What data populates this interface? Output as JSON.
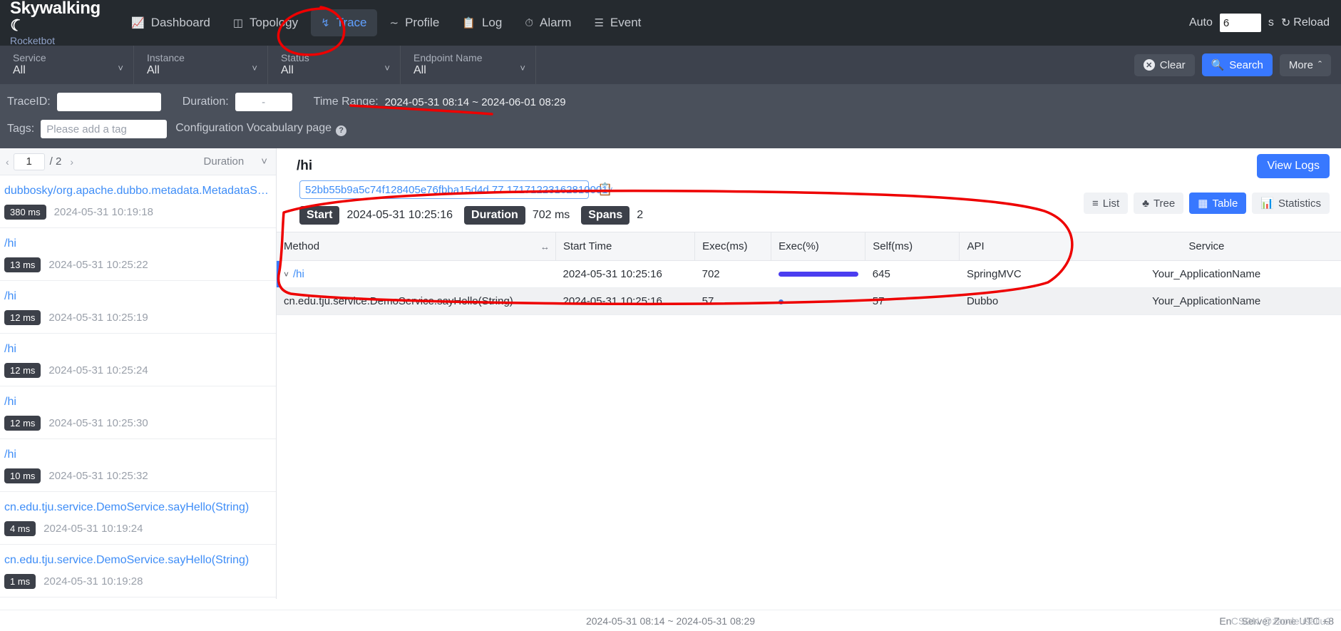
{
  "brand": {
    "name": "Skywalking",
    "sub": "Rocketbot",
    "moon_icon": "moon-icon"
  },
  "nav": {
    "items": [
      {
        "label": "Dashboard",
        "icon": "dashboard-icon",
        "active": false
      },
      {
        "label": "Topology",
        "icon": "topology-icon",
        "active": false
      },
      {
        "label": "Trace",
        "icon": "trace-icon",
        "active": true
      },
      {
        "label": "Profile",
        "icon": "profile-icon",
        "active": false
      },
      {
        "label": "Log",
        "icon": "log-icon",
        "active": false
      },
      {
        "label": "Alarm",
        "icon": "alarm-icon",
        "active": false
      },
      {
        "label": "Event",
        "icon": "event-icon",
        "active": false
      }
    ],
    "auto_label": "Auto",
    "auto_value": "6",
    "seconds_label": "s",
    "reload_label": "Reload",
    "reload_icon": "refresh-icon"
  },
  "filters": {
    "selects": [
      {
        "label": "Service",
        "value": "All"
      },
      {
        "label": "Instance",
        "value": "All"
      },
      {
        "label": "Status",
        "value": "All"
      },
      {
        "label": "Endpoint Name",
        "value": "All"
      }
    ],
    "clear_label": "Clear",
    "search_label": "Search",
    "more_label": "More",
    "traceid_label": "TraceID:",
    "traceid_value": "",
    "traceid_placeholder": "",
    "duration_label": "Duration:",
    "duration_placeholder": "-",
    "duration_value": "",
    "timerange_label": "Time Range:",
    "timerange_value": "2024-05-31 08:14 ~ 2024-06-01 08:29",
    "tags_label": "Tags:",
    "tags_placeholder": "Please add a tag",
    "tags_value": "",
    "config_link": "Configuration Vocabulary page",
    "help_icon": "question-icon"
  },
  "sidebar": {
    "page_current": "1",
    "page_total": "/ 2",
    "prev_icon": "chevron-left-icon",
    "next_icon": "chevron-right-icon",
    "sort_label": "Duration",
    "sort_caret_icon": "chevron-down-icon",
    "items": [
      {
        "name": "dubbosky/org.apache.dubbo.metadata.MetadataServic...",
        "duration": "380 ms",
        "time": "2024-05-31 10:19:18"
      },
      {
        "name": "/hi",
        "duration": "13 ms",
        "time": "2024-05-31 10:25:22"
      },
      {
        "name": "/hi",
        "duration": "12 ms",
        "time": "2024-05-31 10:25:19"
      },
      {
        "name": "/hi",
        "duration": "12 ms",
        "time": "2024-05-31 10:25:24"
      },
      {
        "name": "/hi",
        "duration": "12 ms",
        "time": "2024-05-31 10:25:30"
      },
      {
        "name": "/hi",
        "duration": "10 ms",
        "time": "2024-05-31 10:25:32"
      },
      {
        "name": "cn.edu.tju.service.DemoService.sayHello(String)",
        "duration": "4 ms",
        "time": "2024-05-31 10:19:24"
      },
      {
        "name": "cn.edu.tju.service.DemoService.sayHello(String)",
        "duration": "1 ms",
        "time": "2024-05-31 10:19:28"
      }
    ]
  },
  "detail": {
    "title": "/hi",
    "view_logs_label": "View Logs",
    "trace_id": "52bb55b9a5c74f128405e76fbba15d4d.77.17171223162810001",
    "trace_caret_icon": "chevron-down-icon",
    "copy_icon": "copy-icon",
    "start_label": "Start",
    "start_value": "2024-05-31 10:25:16",
    "duration_label": "Duration",
    "duration_value": "702 ms",
    "spans_label": "Spans",
    "spans_value": "2",
    "view_modes": [
      {
        "label": "List",
        "icon": "list-icon",
        "active": false
      },
      {
        "label": "Tree",
        "icon": "tree-icon",
        "active": false
      },
      {
        "label": "Table",
        "icon": "table-icon",
        "active": true
      },
      {
        "label": "Statistics",
        "icon": "statistics-icon",
        "active": false
      }
    ]
  },
  "table": {
    "columns": [
      "Method",
      "Start Time",
      "Exec(ms)",
      "Exec(%)",
      "Self(ms)",
      "API",
      "Service"
    ],
    "resize_icon": "resize-handle-icon",
    "rows": [
      {
        "expand_icon": "chevron-down-icon",
        "method": "/hi",
        "start_time": "2024-05-31 10:25:16",
        "exec_ms": "702",
        "exec_pct": 100,
        "self_ms": "645",
        "api": "SpringMVC",
        "service": "Your_ApplicationName",
        "is_link": true,
        "indent": false
      },
      {
        "expand_icon": "",
        "method": "cn.edu.tju.service.DemoService.sayHello(String)",
        "start_time": "2024-05-31 10:25:16",
        "exec_ms": "57",
        "exec_pct": 4,
        "self_ms": "57",
        "api": "Dubbo",
        "service": "Your_ApplicationName",
        "is_link": false,
        "indent": true
      }
    ]
  },
  "footer": {
    "time_range": "2024-05-31 08:14 ~ 2024-05-31 08:29",
    "language": "En",
    "server_zone": "Server Zone UTC +8",
    "watermark": "CSDN @zaodeusaliu2"
  },
  "colors": {
    "accent": "#3878ff",
    "link": "#3e8df7",
    "nav_bg": "#252a2f",
    "filter_bg": "#3d424d",
    "filter_bg2": "#4a505b",
    "annotation": "#ee0000",
    "bar": "#4b3df0"
  }
}
